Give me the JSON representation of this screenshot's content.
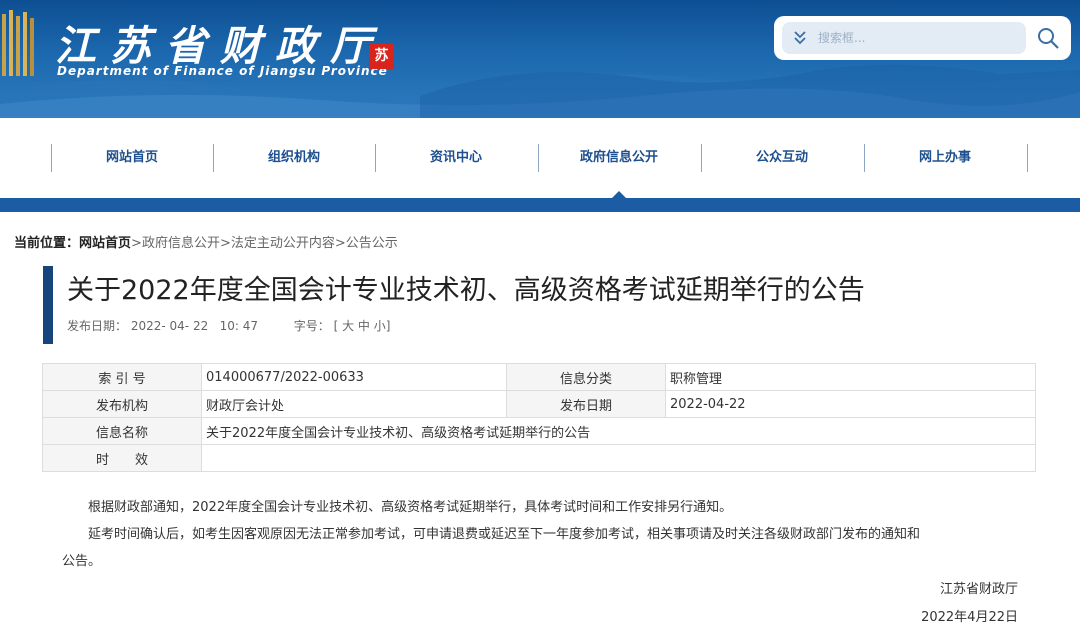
{
  "header": {
    "logo_cn": "江苏省财政厅",
    "logo_en": "Department of Finance of Jiangsu Province",
    "seal_char": "苏",
    "search_placeholder": "搜索框...",
    "colors": {
      "header_top": "#0e4f93",
      "nav_text": "#1e4f8f",
      "band": "#1b5ca4",
      "seal": "#d9241c"
    }
  },
  "nav": {
    "items": [
      "网站首页",
      "组织机构",
      "资讯中心",
      "政府信息公开",
      "公众互动",
      "网上办事"
    ],
    "active_index": 3
  },
  "breadcrumb": {
    "prefix": "当前位置：",
    "home": "网站首页",
    "sep": ">",
    "items": [
      "政府信息公开",
      "法定主动公开内容",
      "公告公示"
    ]
  },
  "article": {
    "title": "关于2022年度全国会计专业技术初、高级资格考试延期举行的公告",
    "publish_label": "发布日期：",
    "publish_value": "2022- 04- 22   10: 47",
    "fontsize_label": "字号：",
    "fontsize_open": "[",
    "fontsize_big": "大",
    "fontsize_mid": "中",
    "fontsize_small": "小",
    "fontsize_close": "]"
  },
  "info_table": {
    "index_label": "索 引 号",
    "index_value": "014000677/2022-00633",
    "category_label": "信息分类",
    "category_value": "职称管理",
    "org_label": "发布机构",
    "org_value": "财政厅会计处",
    "date_label": "发布日期",
    "date_value": "2022-04-22",
    "name_label": "信息名称",
    "name_value": "关于2022年度全国会计专业技术初、高级资格考试延期举行的公告",
    "validity_label": "时　　效",
    "validity_value": ""
  },
  "body": {
    "p1": "根据财政部通知，2022年度全国会计专业技术初、高级资格考试延期举行，具体考试时间和工作安排另行通知。",
    "p2_line1": "延考时间确认后，如考生因客观原因无法正常参加考试，可申请退费或延迟至下一年度参加考试，相关事项请及时关注各级财政部门发布的通知和",
    "p2_line2": "公告。",
    "sign_org": "江苏省财政厅",
    "sign_date": "2022年4月22日"
  }
}
